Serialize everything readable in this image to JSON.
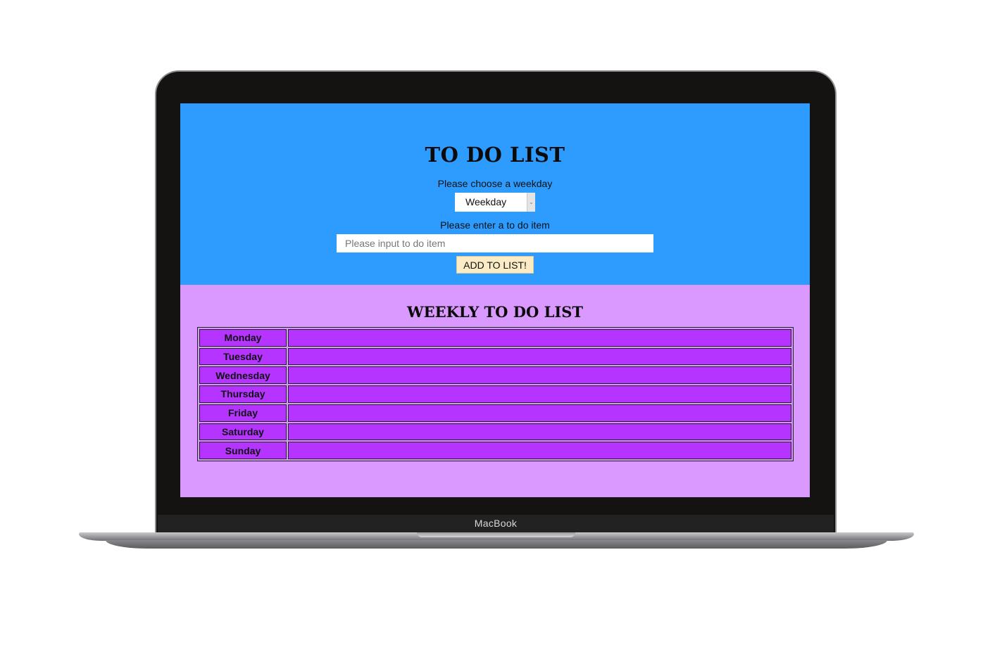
{
  "device": {
    "brand_label": "MacBook"
  },
  "app": {
    "title": "TO DO LIST",
    "weekday_prompt": "Please choose a weekday",
    "weekday_select": {
      "selected": "Weekday"
    },
    "item_prompt": "Please enter a to do item",
    "item_input": {
      "value": "",
      "placeholder": "Please input to do item"
    },
    "add_button_label": "ADD TO LIST!"
  },
  "weekly": {
    "title": "WEEKLY TO DO LIST",
    "rows": [
      {
        "day": "Monday",
        "items": ""
      },
      {
        "day": "Tuesday",
        "items": ""
      },
      {
        "day": "Wednesday",
        "items": ""
      },
      {
        "day": "Thursday",
        "items": ""
      },
      {
        "day": "Friday",
        "items": ""
      },
      {
        "day": "Saturday",
        "items": ""
      },
      {
        "day": "Sunday",
        "items": ""
      }
    ]
  },
  "colors": {
    "top_background": "#2e9bff",
    "bottom_background": "#da99ff",
    "table_cell": "#b534ff",
    "button_background": "#fbecc6"
  }
}
